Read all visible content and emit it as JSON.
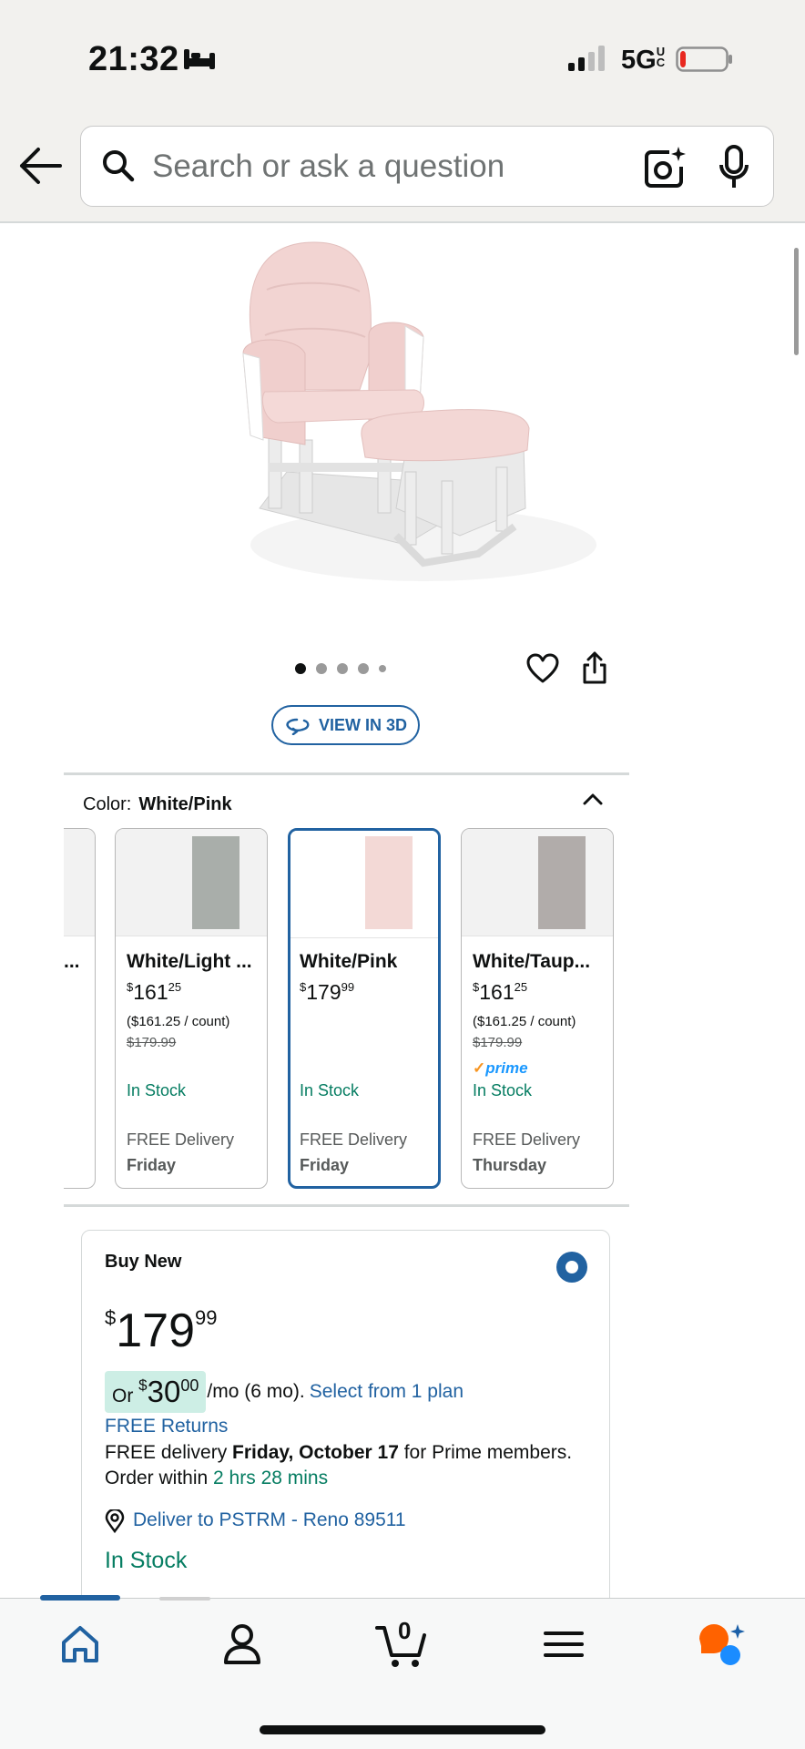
{
  "status_bar": {
    "time": "21:32",
    "network": "5G",
    "network_suffix": "UC",
    "battery_level": 0.1,
    "battery_color": "#e8281f"
  },
  "search": {
    "placeholder": "Search or ask a question",
    "icons": [
      "back-arrow-icon",
      "search-icon",
      "camera-lens-icon",
      "microphone-icon"
    ]
  },
  "gallery": {
    "image_count": 5,
    "active_index": 0,
    "view_3d_label": "VIEW IN 3D"
  },
  "color_selector": {
    "label": "Color:",
    "selected": "White/Pink",
    "options": [
      {
        "name": "White/Light ...",
        "price_whole": "161",
        "price_cents": "25",
        "unit_price": "($161.25 / count)",
        "was_price": "$179.99",
        "prime": false,
        "stock": "In Stock",
        "delivery": "FREE Delivery",
        "delivery_day": "Friday",
        "fabric_color": "#a9aeaa"
      },
      {
        "name": "White/Pink",
        "price_whole": "179",
        "price_cents": "99",
        "unit_price": "",
        "was_price": "",
        "prime": false,
        "stock": "In Stock",
        "delivery": "FREE Delivery",
        "delivery_day": "Friday",
        "fabric_color": "#f3d9d6"
      },
      {
        "name": "White/Taup...",
        "price_whole": "161",
        "price_cents": "25",
        "unit_price": "($161.25 / count)",
        "was_price": "$179.99",
        "prime": true,
        "prime_label": "prime",
        "stock": "In Stock",
        "delivery": "FREE Delivery",
        "delivery_day": "Thursday",
        "fabric_color": "#b1acaa"
      }
    ],
    "partial_option_text": "..."
  },
  "buy_box": {
    "title": "Buy New",
    "price_symbol": "$",
    "price_whole": "179",
    "price_cents": "99",
    "plan_prefix": "Or ",
    "plan_symbol": "$",
    "plan_whole": "30",
    "plan_cents": "00",
    "plan_suffix": "/mo (6 mo).",
    "plan_link": "Select from 1 plan",
    "returns": "FREE Returns",
    "delivery_prefix": "FREE delivery ",
    "delivery_date": "Friday, October 17",
    "delivery_suffix": " for Prime members.",
    "order_prefix": "Order within ",
    "order_time": "2 hrs 28 mins",
    "deliver_to": "Deliver to PSTRM - Reno 89511",
    "stock": "In Stock"
  },
  "bottom_nav": {
    "items": [
      "home-icon",
      "account-icon",
      "cart-icon",
      "menu-icon",
      "rufus-ai-icon"
    ],
    "cart_count": "0",
    "active": "home-icon",
    "accent": "#2162a1"
  }
}
